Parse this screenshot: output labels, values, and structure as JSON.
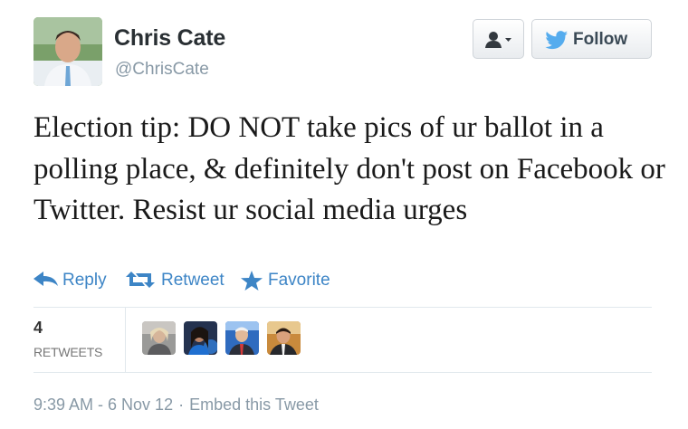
{
  "author": {
    "name": "Chris Cate",
    "handle": "@ChrisCate"
  },
  "header_buttons": {
    "follow_label": "Follow"
  },
  "tweet": {
    "text": "Election tip: DO NOT take pics of ur ballot in a polling place, & definitely don't post on Facebook or Twitter. Resist ur social media urges"
  },
  "actions": {
    "reply": "Reply",
    "retweet": "Retweet",
    "favorite": "Favorite"
  },
  "stats": {
    "retweet_count": "4",
    "retweet_label": "RETWEETS"
  },
  "footer": {
    "timestamp": "9:39 AM - 6 Nov 12",
    "separator": "·",
    "embed_label": "Embed this Tweet"
  },
  "colors": {
    "link_blue": "#3d85c6",
    "twitter_blue": "#55acee",
    "muted_gray": "#8899a6"
  },
  "icons": [
    "user-dropdown-icon",
    "twitter-bird-icon",
    "reply-arrow-icon",
    "retweet-icon",
    "star-icon"
  ]
}
